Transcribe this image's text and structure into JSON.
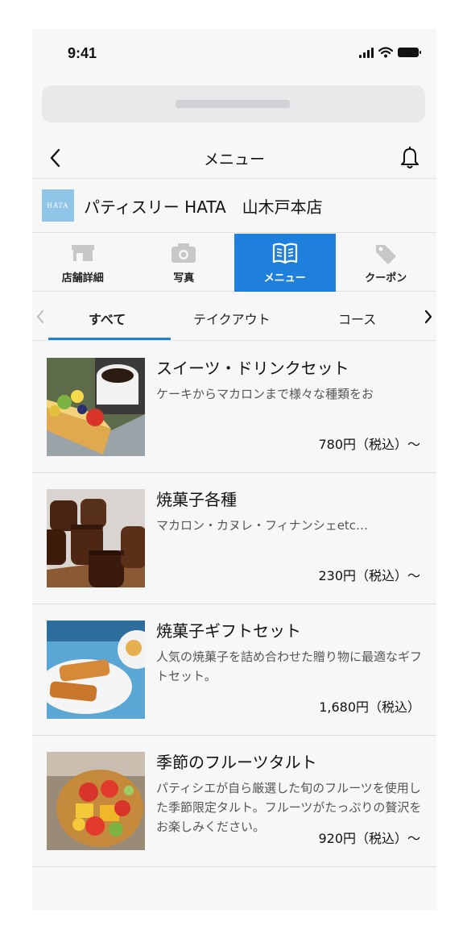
{
  "status": {
    "time": "9:41"
  },
  "header": {
    "title": "メニュー"
  },
  "shop": {
    "logo_text": "HATA",
    "name": "パティスリー HATA　山木戸本店"
  },
  "tabs": [
    {
      "label": "店舗詳細",
      "icon": "store-icon",
      "active": false
    },
    {
      "label": "写真",
      "icon": "camera-icon",
      "active": false
    },
    {
      "label": "メニュー",
      "icon": "menu-book-icon",
      "active": true
    },
    {
      "label": "クーポン",
      "icon": "tag-icon",
      "active": false
    }
  ],
  "subtabs": [
    "すべて",
    "テイクアウト",
    "コース"
  ],
  "items": [
    {
      "title": "スイーツ・ドリンクセット",
      "desc": "ケーキからマカロンまで様々な種類をお",
      "price": "780円（税込）～"
    },
    {
      "title": "焼菓子各種",
      "desc": "マカロン・カヌレ・フィナンシェetc…",
      "price": "230円（税込）～"
    },
    {
      "title": "焼菓子ギフトセット",
      "desc": "人気の焼菓子を詰め合わせた贈り物に最適なギフトセット。",
      "price": "1,680円（税込）"
    },
    {
      "title": "季節のフルーツタルト",
      "desc": "パティシエが自ら厳選した旬のフルーツを使用した季節限定タルト。フルーツがたっぷりの贅沢をお楽しみください。",
      "price": "920円（税込）～"
    }
  ],
  "colors": {
    "accent": "#1e7fdc",
    "logo_bg": "#8fc5e6"
  }
}
